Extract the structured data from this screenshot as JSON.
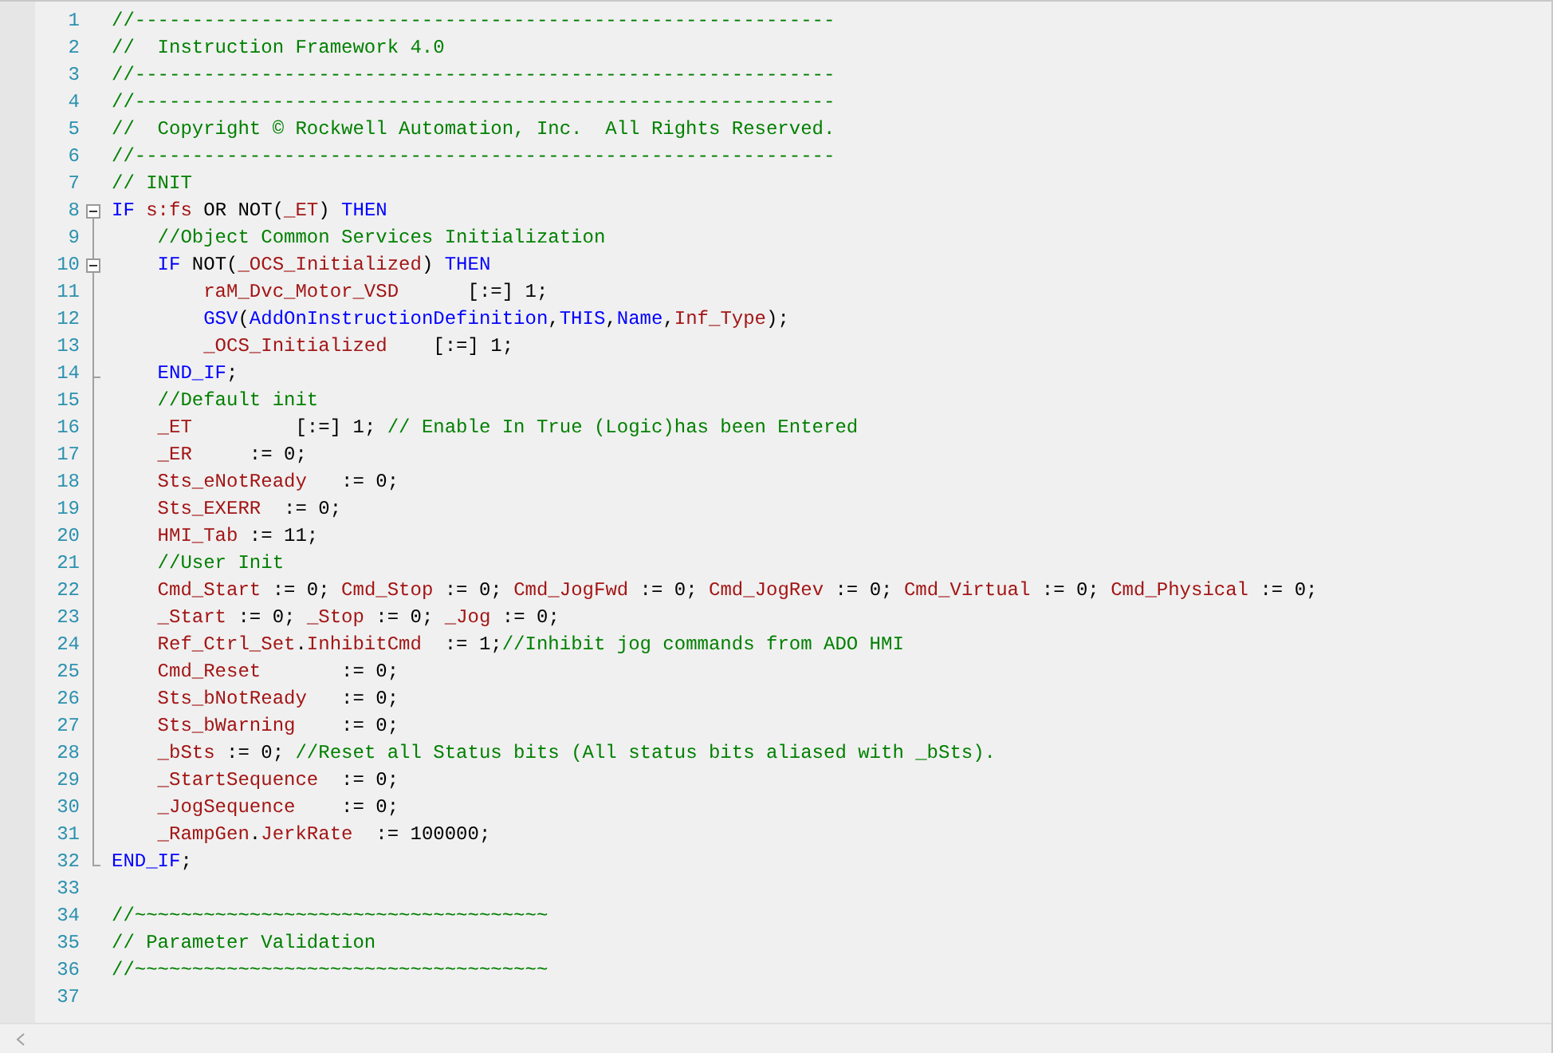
{
  "editor": {
    "lines": [
      {
        "number": "1",
        "kind": "plain",
        "tokens": [
          {
            "kind": "comment",
            "text": "//-------------------------------------------------------------"
          }
        ]
      },
      {
        "number": "2",
        "kind": "plain",
        "tokens": [
          {
            "kind": "comment",
            "text": "//  Instruction Framework 4.0"
          }
        ]
      },
      {
        "number": "3",
        "kind": "plain",
        "tokens": [
          {
            "kind": "comment",
            "text": "//-------------------------------------------------------------"
          }
        ]
      },
      {
        "number": "4",
        "kind": "plain",
        "tokens": [
          {
            "kind": "comment",
            "text": "//-------------------------------------------------------------"
          }
        ]
      },
      {
        "number": "5",
        "kind": "plain",
        "tokens": [
          {
            "kind": "comment",
            "text": "//  Copyright © Rockwell Automation, Inc.  All Rights Reserved."
          }
        ]
      },
      {
        "number": "6",
        "kind": "plain",
        "tokens": [
          {
            "kind": "comment",
            "text": "//-------------------------------------------------------------"
          }
        ]
      },
      {
        "number": "7",
        "kind": "plain",
        "tokens": [
          {
            "kind": "comment",
            "text": "// INIT"
          }
        ]
      },
      {
        "number": "8",
        "kind": "start",
        "expanded": true,
        "tokens": [
          {
            "kind": "keyword",
            "text": "IF"
          },
          {
            "kind": "variable",
            "text": " s:fs"
          },
          {
            "kind": "text",
            "text": " OR NOT("
          },
          {
            "kind": "variable",
            "text": "_ET"
          },
          {
            "kind": "text",
            "text": ") "
          },
          {
            "kind": "keyword",
            "text": "THEN"
          }
        ]
      },
      {
        "number": "9",
        "kind": "inside",
        "tokens": [
          {
            "kind": "comment",
            "text": "    //Object Common Services Initialization"
          }
        ]
      },
      {
        "number": "10",
        "kind": "start",
        "expanded": true,
        "tokens": [
          {
            "kind": "keyword",
            "text": "    IF"
          },
          {
            "kind": "text",
            "text": " NOT("
          },
          {
            "kind": "variable",
            "text": "_OCS_Initialized"
          },
          {
            "kind": "text",
            "text": ") "
          },
          {
            "kind": "keyword",
            "text": "THEN"
          }
        ]
      },
      {
        "number": "11",
        "kind": "inside",
        "tokens": [
          {
            "kind": "variable",
            "text": "        raM_Dvc_Motor_VSD"
          },
          {
            "kind": "text",
            "text": "      [:=] 1;"
          }
        ]
      },
      {
        "number": "12",
        "kind": "inside",
        "tokens": [
          {
            "kind": "keyword",
            "text": "        GSV"
          },
          {
            "kind": "text",
            "text": "("
          },
          {
            "kind": "keyword",
            "text": "AddOnInstructionDefinition"
          },
          {
            "kind": "text",
            "text": ","
          },
          {
            "kind": "keyword",
            "text": "THIS"
          },
          {
            "kind": "text",
            "text": ","
          },
          {
            "kind": "keyword",
            "text": "Name"
          },
          {
            "kind": "text",
            "text": ","
          },
          {
            "kind": "variable",
            "text": "Inf_Type"
          },
          {
            "kind": "text",
            "text": ");"
          }
        ]
      },
      {
        "number": "13",
        "kind": "inside",
        "tokens": [
          {
            "kind": "variable",
            "text": "        _OCS_Initialized"
          },
          {
            "kind": "text",
            "text": "    [:=] 1;"
          }
        ]
      },
      {
        "number": "14",
        "kind": "end",
        "tokens": [
          {
            "kind": "keyword",
            "text": "    END_IF"
          },
          {
            "kind": "text",
            "text": ";"
          }
        ]
      },
      {
        "number": "15",
        "kind": "inside",
        "tokens": [
          {
            "kind": "comment",
            "text": "    //Default init"
          }
        ]
      },
      {
        "number": "16",
        "kind": "inside",
        "tokens": [
          {
            "kind": "variable",
            "text": "    _ET"
          },
          {
            "kind": "text",
            "text": "         [:=] 1; "
          },
          {
            "kind": "comment",
            "text": "// Enable In True (Logic)has been Entered"
          }
        ]
      },
      {
        "number": "17",
        "kind": "inside",
        "tokens": [
          {
            "kind": "variable",
            "text": "    _ER"
          },
          {
            "kind": "text",
            "text": "     := 0;"
          }
        ]
      },
      {
        "number": "18",
        "kind": "inside",
        "tokens": [
          {
            "kind": "variable",
            "text": "    Sts_eNotReady"
          },
          {
            "kind": "text",
            "text": "   := 0;"
          }
        ]
      },
      {
        "number": "19",
        "kind": "inside",
        "tokens": [
          {
            "kind": "variable",
            "text": "    Sts_EXERR"
          },
          {
            "kind": "text",
            "text": "  := 0;"
          }
        ]
      },
      {
        "number": "20",
        "kind": "inside",
        "tokens": [
          {
            "kind": "variable",
            "text": "    HMI_Tab"
          },
          {
            "kind": "text",
            "text": " := 11;"
          }
        ]
      },
      {
        "number": "21",
        "kind": "inside",
        "tokens": [
          {
            "kind": "comment",
            "text": "    //User Init"
          }
        ]
      },
      {
        "number": "22",
        "kind": "inside",
        "tokens": [
          {
            "kind": "variable",
            "text": "    Cmd_Start"
          },
          {
            "kind": "text",
            "text": " := 0; "
          },
          {
            "kind": "variable",
            "text": "Cmd_Stop"
          },
          {
            "kind": "text",
            "text": " := 0; "
          },
          {
            "kind": "variable",
            "text": "Cmd_JogFwd"
          },
          {
            "kind": "text",
            "text": " := 0; "
          },
          {
            "kind": "variable",
            "text": "Cmd_JogRev"
          },
          {
            "kind": "text",
            "text": " := 0; "
          },
          {
            "kind": "variable",
            "text": "Cmd_Virtual"
          },
          {
            "kind": "text",
            "text": " := 0; "
          },
          {
            "kind": "variable",
            "text": "Cmd_Physical"
          },
          {
            "kind": "text",
            "text": " := 0;"
          }
        ]
      },
      {
        "number": "23",
        "kind": "inside",
        "tokens": [
          {
            "kind": "variable",
            "text": "    _Start"
          },
          {
            "kind": "text",
            "text": " := 0; "
          },
          {
            "kind": "variable",
            "text": "_Stop"
          },
          {
            "kind": "text",
            "text": " := 0; "
          },
          {
            "kind": "variable",
            "text": "_Jog"
          },
          {
            "kind": "text",
            "text": " := 0;"
          }
        ]
      },
      {
        "number": "24",
        "kind": "inside",
        "tokens": [
          {
            "kind": "variable",
            "text": "    Ref_Ctrl_Set"
          },
          {
            "kind": "text",
            "text": "."
          },
          {
            "kind": "variable",
            "text": "InhibitCmd"
          },
          {
            "kind": "text",
            "text": "  := 1;"
          },
          {
            "kind": "comment",
            "text": "//Inhibit jog commands from ADO HMI"
          }
        ]
      },
      {
        "number": "25",
        "kind": "inside",
        "tokens": [
          {
            "kind": "variable",
            "text": "    Cmd_Reset"
          },
          {
            "kind": "text",
            "text": "       := 0;"
          }
        ]
      },
      {
        "number": "26",
        "kind": "inside",
        "tokens": [
          {
            "kind": "variable",
            "text": "    Sts_bNotReady"
          },
          {
            "kind": "text",
            "text": "   := 0;"
          }
        ]
      },
      {
        "number": "27",
        "kind": "inside",
        "tokens": [
          {
            "kind": "variable",
            "text": "    Sts_bWarning"
          },
          {
            "kind": "text",
            "text": "    := 0;"
          }
        ]
      },
      {
        "number": "28",
        "kind": "inside",
        "tokens": [
          {
            "kind": "variable",
            "text": "    _bSts"
          },
          {
            "kind": "text",
            "text": " := 0; "
          },
          {
            "kind": "comment",
            "text": "//Reset all Status bits (All status bits aliased with _bSts)."
          }
        ]
      },
      {
        "number": "29",
        "kind": "inside",
        "tokens": [
          {
            "kind": "variable",
            "text": "    _StartSequence"
          },
          {
            "kind": "text",
            "text": "  := 0;"
          }
        ]
      },
      {
        "number": "30",
        "kind": "inside",
        "tokens": [
          {
            "kind": "variable",
            "text": "    _JogSequence"
          },
          {
            "kind": "text",
            "text": "    := 0;"
          }
        ]
      },
      {
        "number": "31",
        "kind": "inside",
        "tokens": [
          {
            "kind": "variable",
            "text": "    _RampGen"
          },
          {
            "kind": "text",
            "text": "."
          },
          {
            "kind": "variable",
            "text": "JerkRate"
          },
          {
            "kind": "text",
            "text": "  := 100000;"
          }
        ]
      },
      {
        "number": "32",
        "kind": "end",
        "tokens": [
          {
            "kind": "keyword",
            "text": "END_IF"
          },
          {
            "kind": "text",
            "text": ";"
          }
        ]
      },
      {
        "number": "33",
        "kind": "plain"
      },
      {
        "number": "34",
        "kind": "plain",
        "tokens": [
          {
            "kind": "comment",
            "text": "//~~~~~~~~~~~~~~~~~~~~~~~~~~~~~~~~~~~~"
          }
        ]
      },
      {
        "number": "35",
        "kind": "plain",
        "tokens": [
          {
            "kind": "comment",
            "text": "// Parameter Validation"
          }
        ]
      },
      {
        "number": "36",
        "kind": "plain",
        "tokens": [
          {
            "kind": "comment",
            "text": "//~~~~~~~~~~~~~~~~~~~~~~~~~~~~~~~~~~~~"
          }
        ]
      },
      {
        "number": "37",
        "kind": "plain"
      }
    ]
  }
}
